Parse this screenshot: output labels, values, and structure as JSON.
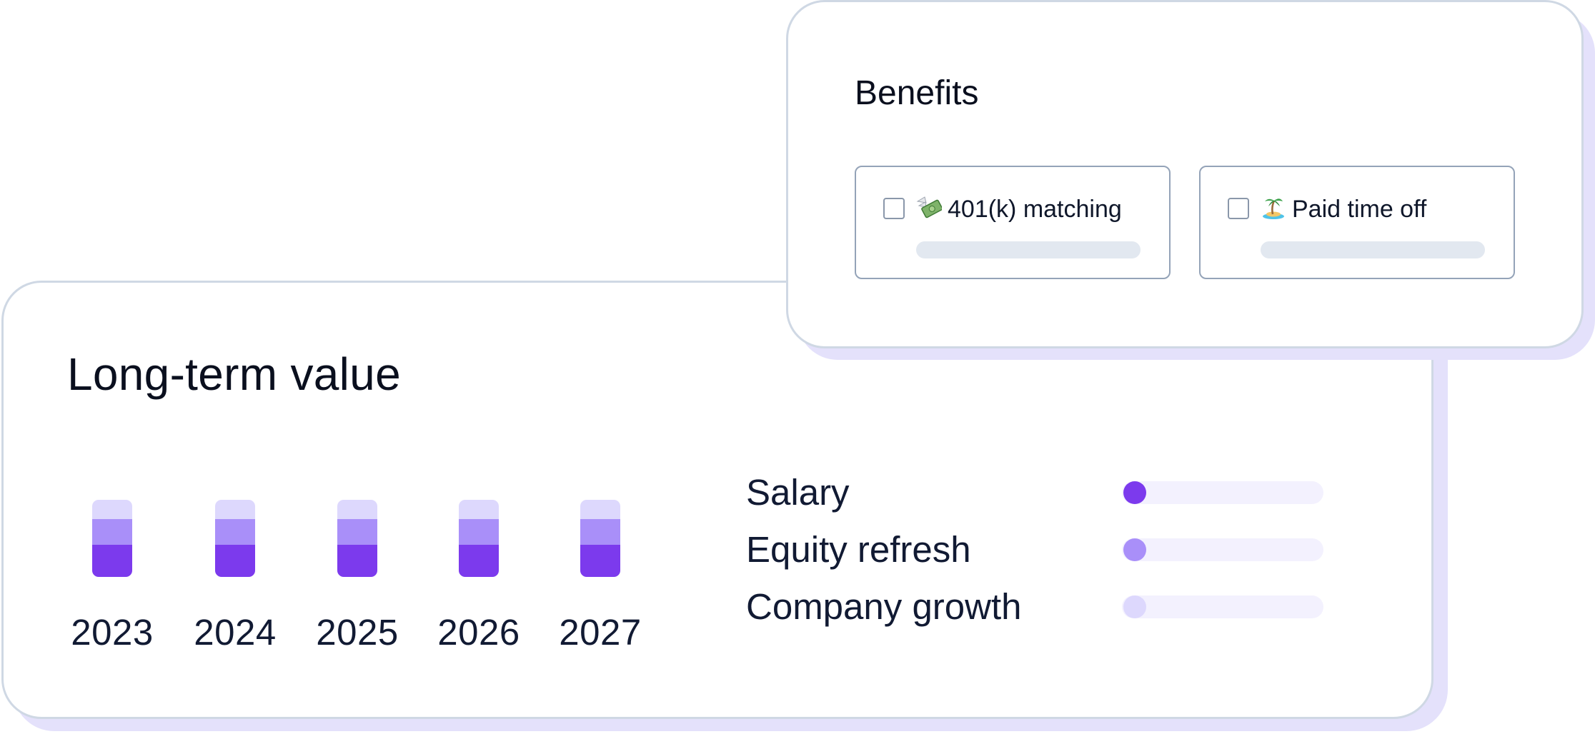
{
  "long_term_value": {
    "title": "Long-term value",
    "years": [
      "2023",
      "2024",
      "2025",
      "2026",
      "2027"
    ],
    "metrics": [
      {
        "label": "Salary",
        "color": "#7c3aed"
      },
      {
        "label": "Equity refresh",
        "color": "#a98ff9"
      },
      {
        "label": "Company growth",
        "color": "#ddd8fd"
      }
    ],
    "segment_colors": [
      "#ddd8fd",
      "#a98ff9",
      "#7c3aed"
    ]
  },
  "benefits": {
    "title": "Benefits",
    "options": [
      {
        "emoji_icon": "money-with-wings-icon",
        "label": "401(k) matching",
        "checked": false
      },
      {
        "emoji_icon": "desert-island-icon",
        "label": "Paid time off",
        "checked": false
      }
    ]
  }
}
